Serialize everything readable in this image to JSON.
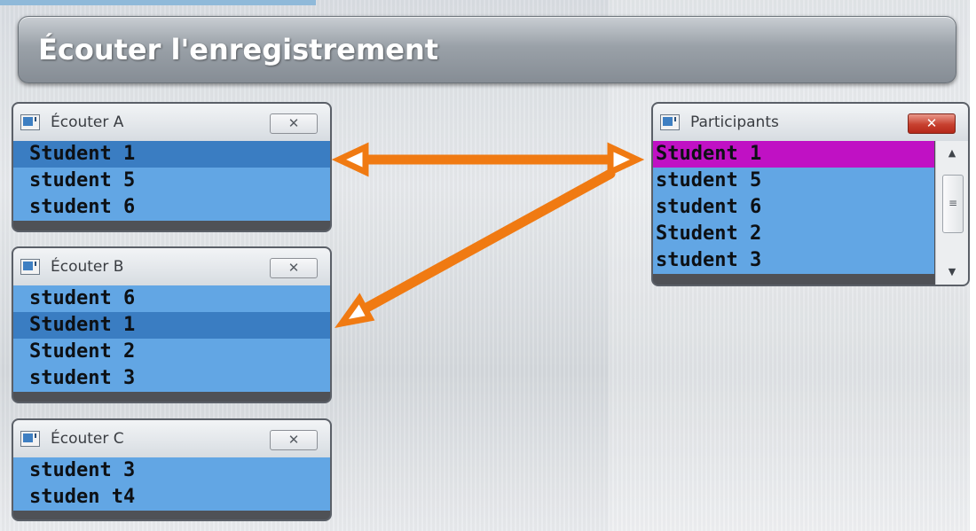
{
  "header": {
    "title": "Écouter l'enregistrement"
  },
  "windows": [
    {
      "title": "Écouter A",
      "close_icon": "close-icon",
      "rows": [
        "Student 1",
        "student 5",
        "student 6"
      ],
      "selected_index": 0
    },
    {
      "title": "Écouter B",
      "close_icon": "close-icon",
      "rows": [
        "student 6",
        "Student 1",
        "Student 2",
        "student 3"
      ],
      "selected_index": 1
    },
    {
      "title": "Écouter C",
      "close_icon": "close-icon",
      "rows": [
        "student 3",
        "studen t4"
      ]
    }
  ],
  "participants": {
    "title": "Participants",
    "close_icon": "close-icon",
    "rows": [
      "Student 1",
      "student 5",
      "student 6",
      "Student 2",
      "student 3"
    ],
    "highlighted_index": 0,
    "scrollbar": {
      "up_icon": "arrow-up-icon",
      "down_icon": "arrow-down-icon",
      "thumb_icon": "grip-icon"
    }
  },
  "colors": {
    "list_bg": "#62a6e4",
    "list_selected": "#3a7dc2",
    "participant_highlight": "#c011c4",
    "arrow": "#f07a12",
    "close_red": "#c7402f"
  },
  "annotations": {
    "arrow_icons": [
      "double-arrow-icon",
      "arrow-icon"
    ]
  }
}
